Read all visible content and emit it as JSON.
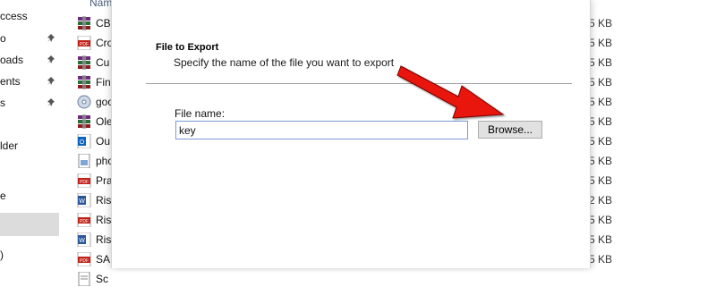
{
  "sidebar": {
    "items": [
      {
        "label": "ccess"
      },
      {
        "label": "o"
      },
      {
        "label": "oads"
      },
      {
        "label": "ents"
      },
      {
        "label": "s"
      },
      {
        "label": "lder"
      },
      {
        "label": "e"
      },
      {
        "label": ")"
      }
    ]
  },
  "file_list": {
    "column_header": "Name",
    "files": [
      {
        "name": "CB",
        "icon": "winrar-archive-icon"
      },
      {
        "name": "Cro",
        "icon": "pdf-file-icon"
      },
      {
        "name": "Cu",
        "icon": "winrar-archive-icon"
      },
      {
        "name": "Fin",
        "icon": "winrar-archive-icon"
      },
      {
        "name": "goo",
        "icon": "installer-disc-icon"
      },
      {
        "name": "Ole",
        "icon": "winrar-archive-icon"
      },
      {
        "name": "Ou",
        "icon": "outlook-file-icon"
      },
      {
        "name": "pho",
        "icon": "image-file-icon"
      },
      {
        "name": "Pra",
        "icon": "pdf-file-icon"
      },
      {
        "name": "Ris",
        "icon": "word-file-icon"
      },
      {
        "name": "Ris",
        "icon": "pdf-file-icon"
      },
      {
        "name": "Ris",
        "icon": "word-file-icon"
      },
      {
        "name": "SA",
        "icon": "pdf-file-icon"
      },
      {
        "name": "Sc",
        "icon": "text-file-icon"
      }
    ]
  },
  "sizes": [
    "5 KB",
    "5 KB",
    "5 KB",
    "5 KB",
    "5 KB",
    "5 KB",
    "5 KB",
    "5 KB",
    "5 KB",
    "2 KB",
    "5 KB",
    "5 KB",
    "5 KB",
    "5 KB"
  ],
  "dialog": {
    "title": "File to Export",
    "subtitle": "Specify the name of the file you want to export",
    "file_name_label": "File name:",
    "file_name_value": "key",
    "browse_label": "Browse..."
  },
  "colors": {
    "arrow": "#e8120c",
    "input_border": "#7a9ccf",
    "button_bg": "#e1e1e1"
  }
}
